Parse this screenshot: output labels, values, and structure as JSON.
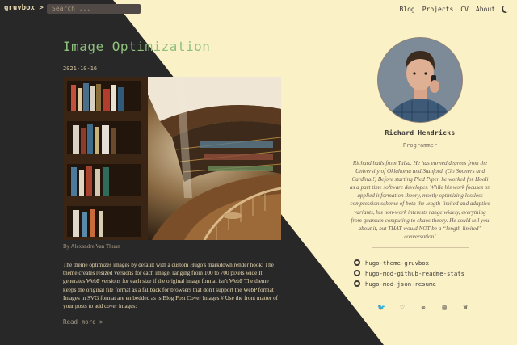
{
  "header": {
    "brand": "gruvbox >",
    "search_placeholder": "Search ...",
    "nav": [
      "Blog",
      "Projects",
      "CV",
      "About"
    ]
  },
  "post": {
    "title": "Image Optimization",
    "date": "2021-10-16",
    "caption": "By Alexandre Van Thuan",
    "excerpt": "The theme optimizes images by default with a custom Hugo's markdown render hook: The theme creates resized versions for each image, ranging from 100 to 700 pixels wide It generates WebP versions for each size if the original image format isn't WebP The theme keeps the original file format as a fallback for browsers that don't support the WebP format Images in SVG format are embedded as is Blog Post Cover Images # Use the front matter of your posts to add cover images:",
    "read_more": "Read more >"
  },
  "profile": {
    "name": "Richard Hendricks",
    "role": "Programmer",
    "bio": "Richard hails from Tulsa. He has earned degrees from the University of Oklahoma and Stanford. (Go Sooners and Cardinal!) Before starting Pied Piper, he worked for Hooli as a part time software developer. While his work focuses on applied information theory, mostly optimizing lossless compression schema of both the length-limited and adaptive variants, his non-work interests range widely, everything from quantum computing to chaos theory. He could tell you about it, but THAT would NOT be a “length-limited” conversation!",
    "links": [
      "hugo-theme-gruvbox",
      "hugo-mod-github-readme-stats",
      "hugo-mod-json-resume"
    ],
    "social": [
      {
        "icon": "twitter-icon",
        "glyph": "🐦"
      },
      {
        "icon": "keybase-icon",
        "glyph": "♡"
      },
      {
        "icon": "ello-icon",
        "glyph": "∞"
      },
      {
        "icon": "stackexchange-icon",
        "glyph": "▤"
      },
      {
        "icon": "wikipedia-icon",
        "glyph": "W"
      }
    ]
  },
  "colors": {
    "dark_bg": "#282828",
    "light_bg": "#fbf1c7",
    "accent": "#8ec07c"
  }
}
